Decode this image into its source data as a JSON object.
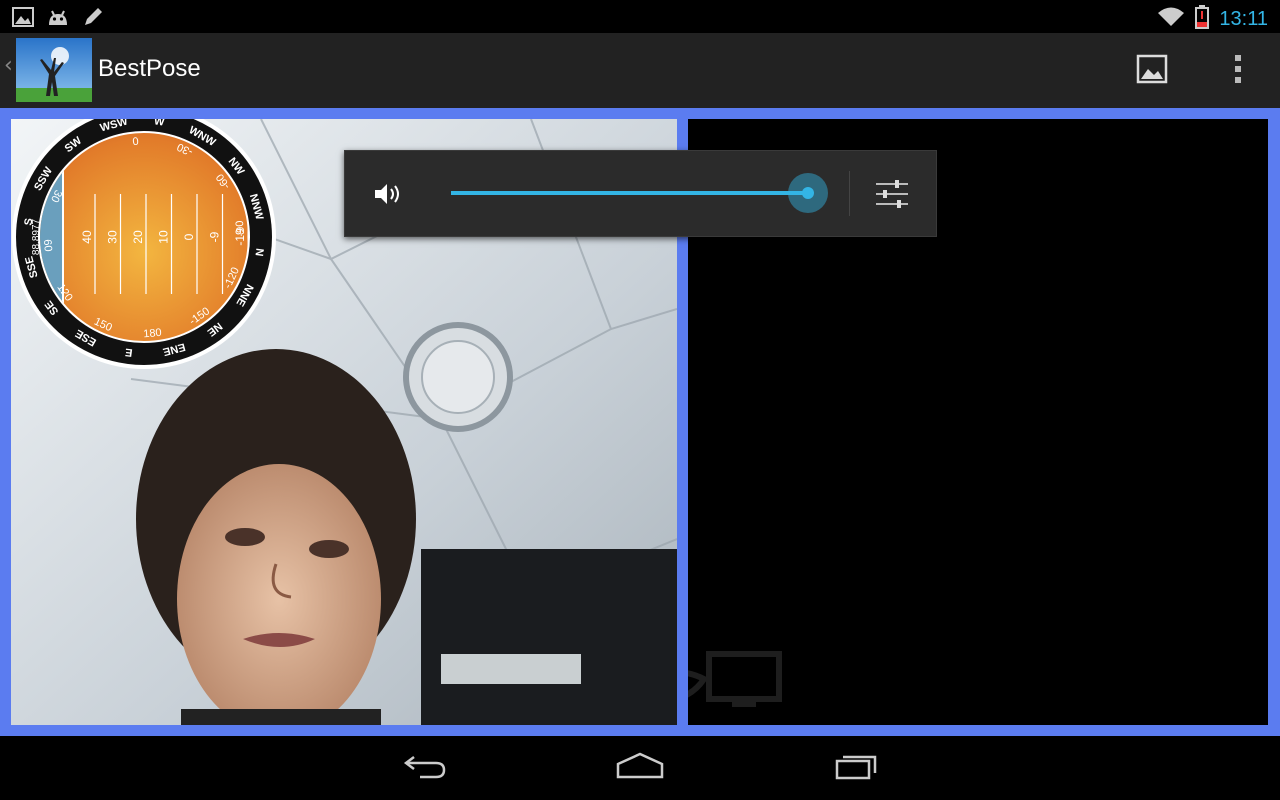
{
  "status_bar": {
    "time": "13:11",
    "notification_icons": [
      "picture-icon",
      "android-icon",
      "pencil-icon"
    ],
    "system_icons": [
      "wifi-icon",
      "battery-low-icon"
    ],
    "clock_color": "#33b5e5"
  },
  "action_bar": {
    "title": "BestPose",
    "actions": [
      "gallery-icon",
      "overflow-menu-icon"
    ]
  },
  "compass": {
    "directions": [
      "SSW",
      "SW",
      "WSW",
      "W",
      "WNW",
      "NW",
      "NNW",
      "N",
      "NNE",
      "NE",
      "ENE",
      "E",
      "ESE",
      "SE",
      "SSE",
      "S"
    ],
    "heading_labels": [
      "0",
      "-30",
      "-60",
      "-90",
      "-120",
      "-150",
      "180",
      "150",
      "120",
      "60",
      "30"
    ],
    "tilt_labels": [
      "40",
      "30",
      "20",
      "10",
      "0",
      "-9",
      "-19"
    ],
    "side_value": "88.8977"
  },
  "volume_panel": {
    "level_fraction": 1.0,
    "accent_color": "#33b5e5"
  },
  "content": {
    "frame_color": "#5b7cf0"
  },
  "nav_bar": {
    "buttons": [
      "back-icon",
      "home-icon",
      "recent-apps-icon"
    ]
  }
}
